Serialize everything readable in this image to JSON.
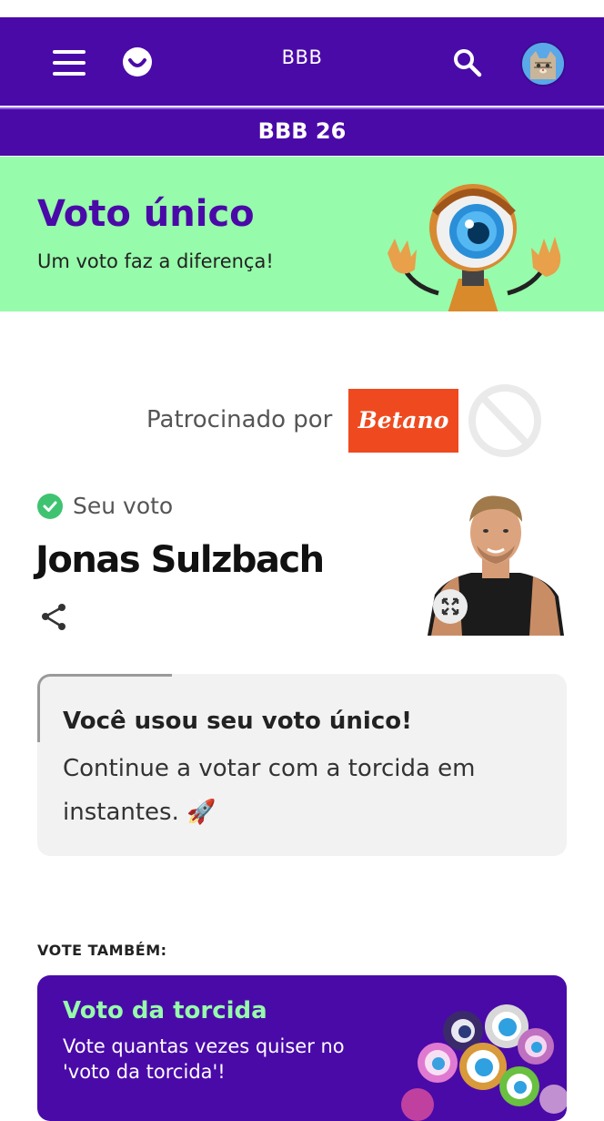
{
  "header": {
    "title": "BBB",
    "menu_icon": "hamburger-menu-icon",
    "logo_icon": "globoplay-logo-icon",
    "search_icon": "search-icon",
    "avatar_icon": "cat-avatar-icon"
  },
  "subheader": {
    "title": "BBB 26"
  },
  "banner": {
    "title": "Voto único",
    "subtitle": "Um voto faz a diferença!",
    "background": "#96fbaa",
    "title_color": "#4a0aa8"
  },
  "sponsor": {
    "label": "Patrocinado por",
    "brand": "Betano",
    "brand_color": "#ef4a1f"
  },
  "vote": {
    "status_label": "Seu voto",
    "candidate_name": "Jonas Sulzbach",
    "check_color": "#3fc371"
  },
  "notice": {
    "title": "Você usou seu voto único!",
    "body": "Continue a votar com a torcida em instantes. 🚀"
  },
  "also": {
    "label": "VOTE TAMBÉM:",
    "card_title": "Voto da torcida",
    "card_text": "Vote quantas vezes quiser no 'voto da torcida'!",
    "card_background": "#4a0aa8",
    "card_title_color": "#96fbaa"
  },
  "colors": {
    "brand_purple": "#4a0aa8",
    "mint": "#96fbaa"
  }
}
